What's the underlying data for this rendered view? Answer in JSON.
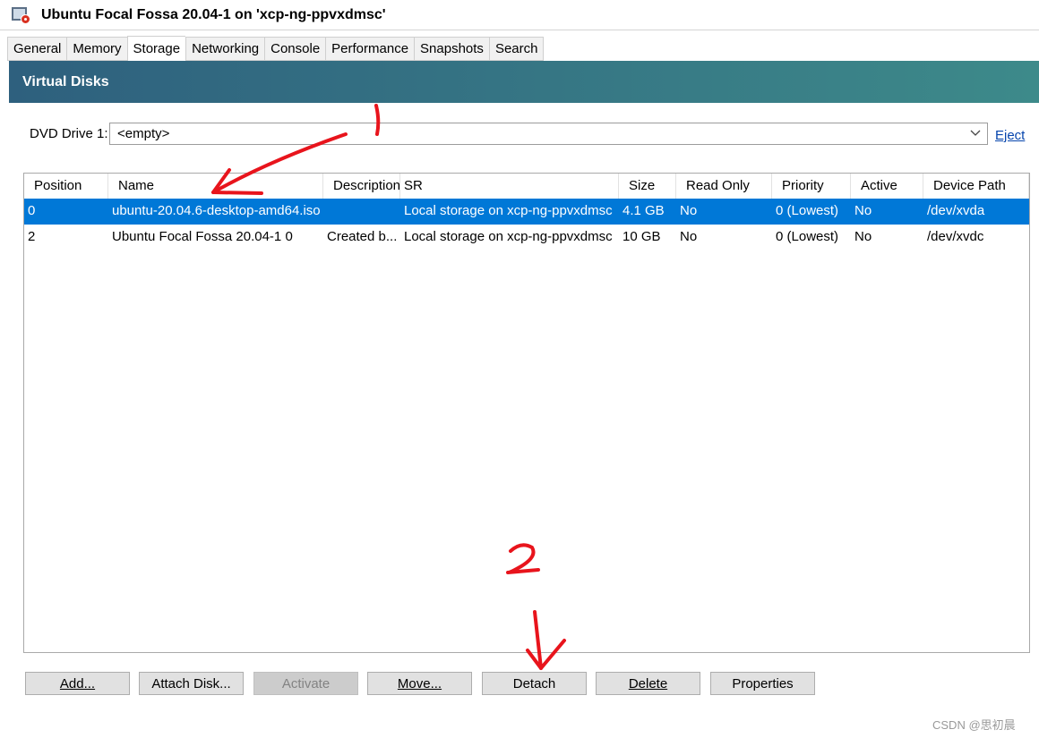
{
  "window": {
    "title": "Ubuntu Focal Fossa 20.04-1 on 'xcp-ng-ppvxdmsc'"
  },
  "tabs": [
    {
      "label": "General",
      "active": false
    },
    {
      "label": "Memory",
      "active": false
    },
    {
      "label": "Storage",
      "active": true
    },
    {
      "label": "Networking",
      "active": false
    },
    {
      "label": "Console",
      "active": false
    },
    {
      "label": "Performance",
      "active": false
    },
    {
      "label": "Snapshots",
      "active": false
    },
    {
      "label": "Search",
      "active": false
    }
  ],
  "panel": {
    "title": "Virtual Disks"
  },
  "dvd": {
    "label": "DVD Drive 1:",
    "value": "<empty>",
    "eject": "Eject"
  },
  "grid": {
    "columns": [
      "Position",
      "Name",
      "Description",
      "SR",
      "Size",
      "Read Only",
      "Priority",
      "Active",
      "Device Path"
    ],
    "rows": [
      {
        "selected": true,
        "cells": [
          "0",
          "ubuntu-20.04.6-desktop-amd64.iso",
          "",
          "Local storage on xcp-ng-ppvxdmsc",
          "4.1 GB",
          "No",
          "0 (Lowest)",
          "No",
          "/dev/xvda"
        ]
      },
      {
        "selected": false,
        "cells": [
          "2",
          "Ubuntu Focal Fossa 20.04-1 0",
          "Created b...",
          "Local storage on xcp-ng-ppvxdmsc",
          "10 GB",
          "No",
          "0 (Lowest)",
          "No",
          "/dev/xvdc"
        ]
      }
    ]
  },
  "buttons": {
    "add": "Add...",
    "attach_disk": "Attach Disk...",
    "activate": "Activate",
    "move": "Move...",
    "detach": "Detach",
    "delete": "Delete",
    "properties": "Properties"
  },
  "annotations": {
    "mark1": "1",
    "mark2": "2",
    "color": "#e8141c"
  },
  "watermark": "CSDN @思初晨",
  "colors": {
    "header_start": "#2e607e",
    "header_end": "#3d8a8a",
    "selection": "#0078d7",
    "link": "#0645ad"
  }
}
